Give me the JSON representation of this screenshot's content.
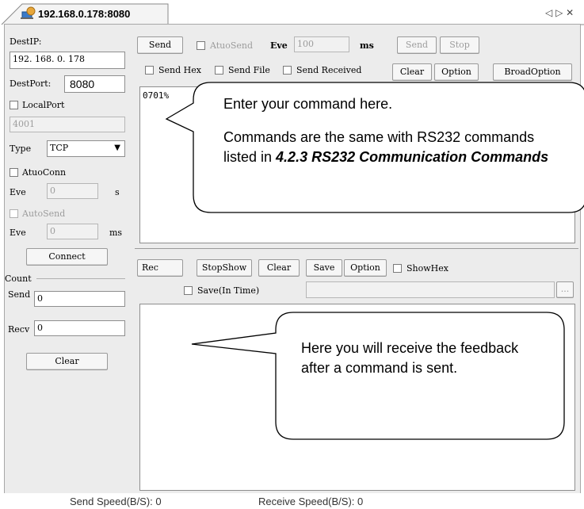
{
  "tab": {
    "title": "192.168.0.178:8080",
    "nav_icons": [
      "◁",
      "▷",
      "✕"
    ]
  },
  "left": {
    "dest_ip_label": "DestIP:",
    "dest_ip_value": "192. 168. 0. 178",
    "dest_port_label": "DestPort:",
    "dest_port_value": "8080",
    "local_port_label": "LocalPort",
    "local_port_value": "4001",
    "type_label": "Type",
    "type_value": "TCP",
    "auto_conn_label": "AtuoConn",
    "eve_label": "Eve",
    "auto_conn_eve_value": "0",
    "auto_conn_unit": "s",
    "auto_send_label": "AutoSend",
    "auto_send_eve_value": "0",
    "auto_send_unit": "ms",
    "connect_label": "Connect",
    "count_label": "Count",
    "send_label": "Send",
    "send_count": "0",
    "recv_label": "Recv",
    "recv_count": "0",
    "clear_label": "Clear"
  },
  "send_panel": {
    "send_tab_label": "Send",
    "auto_send_label": "AtuoSend",
    "eve_label": "Eve",
    "eve_value": "100",
    "unit": "ms",
    "send_button": "Send",
    "stop_button": "Stop",
    "send_hex_label": "Send Hex",
    "send_file_label": "Send File",
    "send_received_label": "Send Received",
    "clear_button": "Clear",
    "option_button": "Option",
    "broad_option_button": "BroadOption",
    "command_text": "0701%"
  },
  "rec_panel": {
    "rec_tab_label": "Rec",
    "stop_show_button": "StopShow",
    "clear_button": "Clear",
    "save_button": "Save",
    "option_button": "Option",
    "show_hex_label": "ShowHex",
    "save_in_time_label": "Save(In Time)",
    "browse_button": "..."
  },
  "callouts": {
    "top_line1": "Enter your command here.",
    "top_line2": "Commands are the same with RS232 commands listed in ",
    "top_ref": "4.2.3 RS232 Communication Commands",
    "bottom": "Here you will receive the feedback after a command is sent."
  },
  "status": {
    "send_speed": "Send Speed(B/S): 0",
    "receive_speed": "Receive Speed(B/S): 0"
  }
}
